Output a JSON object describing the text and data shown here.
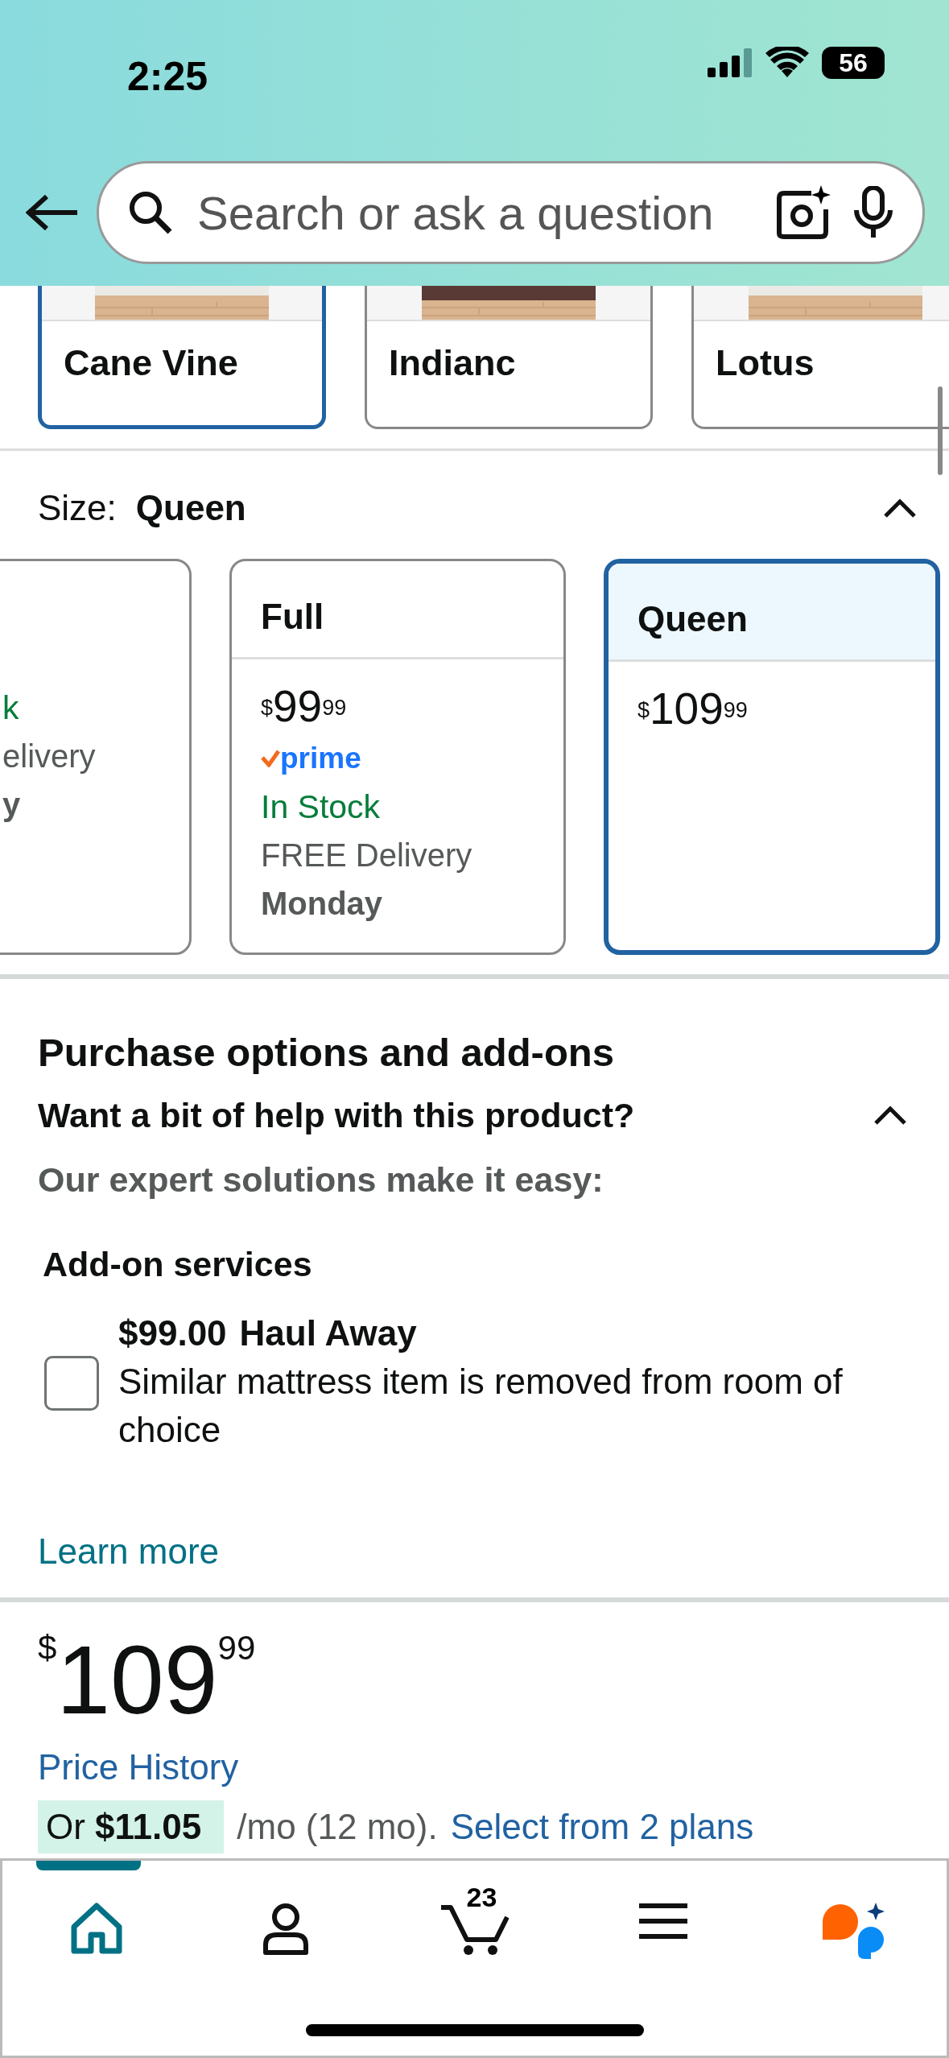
{
  "status_bar": {
    "time": "2:25",
    "battery": "56"
  },
  "search": {
    "placeholder": "Search or ask a question"
  },
  "styles": [
    {
      "label": "Cane Vine",
      "selected": true
    },
    {
      "label": "Indianc",
      "selected": false
    },
    {
      "label": "Lotus",
      "selected": false
    }
  ],
  "size": {
    "label": "Size:",
    "value": "Queen",
    "expanded": true
  },
  "sizes": [
    {
      "stock": "k",
      "delivery": "elivery",
      "delivery_day": "y",
      "selected": false
    },
    {
      "name": "Full",
      "currency": "$",
      "price_whole": "99",
      "price_fraction": "99",
      "prime": "prime",
      "stock": "In Stock",
      "delivery": "FREE Delivery",
      "delivery_day": "Monday",
      "selected": false
    },
    {
      "name": "Queen",
      "currency": "$",
      "price_whole": "109",
      "price_fraction": "99",
      "selected": true
    }
  ],
  "purchase": {
    "title": "Purchase options and add-ons",
    "help_title": "Want a bit of help with this product?",
    "help_subtitle": "Our expert solutions make it easy:",
    "expanded": true,
    "addons_title": "Add-on services",
    "addons": [
      {
        "price": "$99.00",
        "name": "Haul Away",
        "description": "Similar mattress item is removed from room of choice",
        "checked": false
      }
    ],
    "link": "Learn more"
  },
  "price": {
    "currency": "$",
    "whole": "109",
    "fraction": "99",
    "history_link": "Price History",
    "installment": {
      "prefix": "Or",
      "amount": "$11.05",
      "suffix": "/mo (12 mo).",
      "link": "Select from 2 plans"
    }
  },
  "nav": [
    {
      "kind": "home",
      "selected": true
    },
    {
      "kind": "account",
      "selected": false
    },
    {
      "kind": "cart",
      "count": "23",
      "selected": false
    },
    {
      "kind": "menu",
      "selected": false
    },
    {
      "kind": "assistant",
      "selected": false
    }
  ]
}
